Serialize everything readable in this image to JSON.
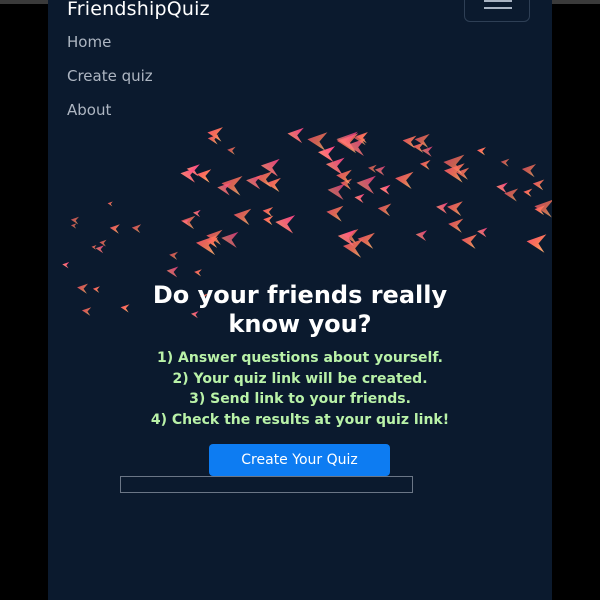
{
  "navbar": {
    "brand": "FriendshipQuiz",
    "toggle_icon": "hamburger-icon",
    "menu": [
      {
        "label": "Home"
      },
      {
        "label": "Create quiz"
      },
      {
        "label": "About"
      }
    ]
  },
  "hero": {
    "headline_line1": "Do your friends really",
    "headline_line2": "know you?",
    "steps": [
      "1) Answer questions about yourself.",
      "2) Your quiz link will be created.",
      "3) Send link to your friends.",
      "4) Check the results at your quiz link!"
    ],
    "cta_label": "Create Your Quiz"
  },
  "colors": {
    "background": "#0b1a2e",
    "steps_text": "#b9f2a8",
    "cta": "#0d7cf2"
  }
}
